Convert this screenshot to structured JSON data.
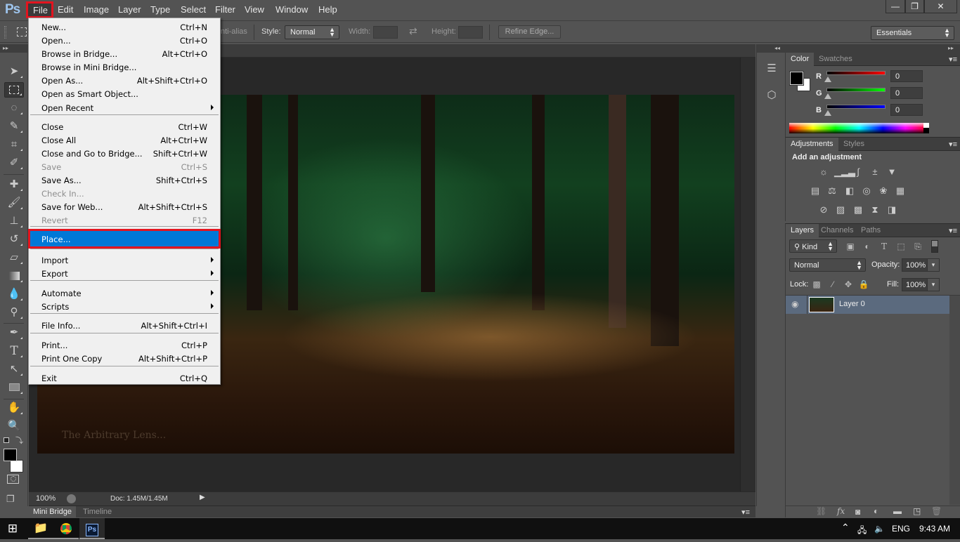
{
  "app": {
    "logo": "Ps"
  },
  "menubar": {
    "items": [
      {
        "label": "File"
      },
      {
        "label": "Edit"
      },
      {
        "label": "Image"
      },
      {
        "label": "Layer"
      },
      {
        "label": "Type"
      },
      {
        "label": "Select"
      },
      {
        "label": "Filter"
      },
      {
        "label": "View"
      },
      {
        "label": "Window"
      },
      {
        "label": "Help"
      }
    ],
    "window_controls": {
      "minimize": "—",
      "restore": "❐",
      "close": "✕"
    }
  },
  "options_bar": {
    "anti_alias_label": "nti-alias",
    "style_label": "Style:",
    "style_value": "Normal",
    "width_label": "Width:",
    "height_label": "Height:",
    "swap_icon": "⇄",
    "refine_edge_label": "Refine Edge...",
    "workspace_value": "Essentials"
  },
  "file_menu": {
    "items": [
      {
        "label": "New...",
        "shortcut": "Ctrl+N"
      },
      {
        "label": "Open...",
        "shortcut": "Ctrl+O"
      },
      {
        "label": "Browse in Bridge...",
        "shortcut": "Alt+Ctrl+O"
      },
      {
        "label": "Browse in Mini Bridge...",
        "shortcut": ""
      },
      {
        "label": "Open As...",
        "shortcut": "Alt+Shift+Ctrl+O"
      },
      {
        "label": "Open as Smart Object...",
        "shortcut": ""
      },
      {
        "label": "Open Recent",
        "shortcut": ""
      },
      {
        "label": "Close",
        "shortcut": "Ctrl+W"
      },
      {
        "label": "Close All",
        "shortcut": "Alt+Ctrl+W"
      },
      {
        "label": "Close and Go to Bridge...",
        "shortcut": "Shift+Ctrl+W"
      },
      {
        "label": "Save",
        "shortcut": "Ctrl+S"
      },
      {
        "label": "Save As...",
        "shortcut": "Shift+Ctrl+S"
      },
      {
        "label": "Check In...",
        "shortcut": ""
      },
      {
        "label": "Save for Web...",
        "shortcut": "Alt+Shift+Ctrl+S"
      },
      {
        "label": "Revert",
        "shortcut": "F12"
      },
      {
        "label": "Place...",
        "shortcut": ""
      },
      {
        "label": "Import",
        "shortcut": ""
      },
      {
        "label": "Export",
        "shortcut": ""
      },
      {
        "label": "Automate",
        "shortcut": ""
      },
      {
        "label": "Scripts",
        "shortcut": ""
      },
      {
        "label": "File Info...",
        "shortcut": "Alt+Shift+Ctrl+I"
      },
      {
        "label": "Print...",
        "shortcut": "Ctrl+P"
      },
      {
        "label": "Print One Copy",
        "shortcut": "Alt+Shift+Ctrl+P"
      },
      {
        "label": "Exit",
        "shortcut": "Ctrl+Q"
      }
    ]
  },
  "canvas": {
    "watermark": "The Arbitrary Lens..."
  },
  "status_bar": {
    "zoom": "100%",
    "doc_info": "Doc: 1.45M/1.45M"
  },
  "bottom_tabs": [
    {
      "label": "Mini Bridge"
    },
    {
      "label": "Timeline"
    }
  ],
  "color_panel": {
    "tabs": [
      {
        "label": "Color"
      },
      {
        "label": "Swatches"
      }
    ],
    "channels": [
      {
        "label": "R",
        "value": "0",
        "color": "#ff0000"
      },
      {
        "label": "G",
        "value": "0",
        "color": "#00ff00"
      },
      {
        "label": "B",
        "value": "0",
        "color": "#0000ff"
      }
    ],
    "foreground": "#000000",
    "background": "#ffffff"
  },
  "adjustments_panel": {
    "tabs": [
      {
        "label": "Adjustments"
      },
      {
        "label": "Styles"
      }
    ],
    "heading": "Add an adjustment"
  },
  "layers_panel": {
    "tabs": [
      {
        "label": "Layers"
      },
      {
        "label": "Channels"
      },
      {
        "label": "Paths"
      }
    ],
    "filter_kind": "Kind",
    "blend_mode": "Normal",
    "opacity_label": "Opacity:",
    "opacity_value": "100%",
    "lock_label": "Lock:",
    "fill_label": "Fill:",
    "fill_value": "100%",
    "layers": [
      {
        "name": "Layer 0",
        "visible": true
      }
    ]
  },
  "taskbar": {
    "language": "ENG",
    "time": "9:43 AM"
  }
}
